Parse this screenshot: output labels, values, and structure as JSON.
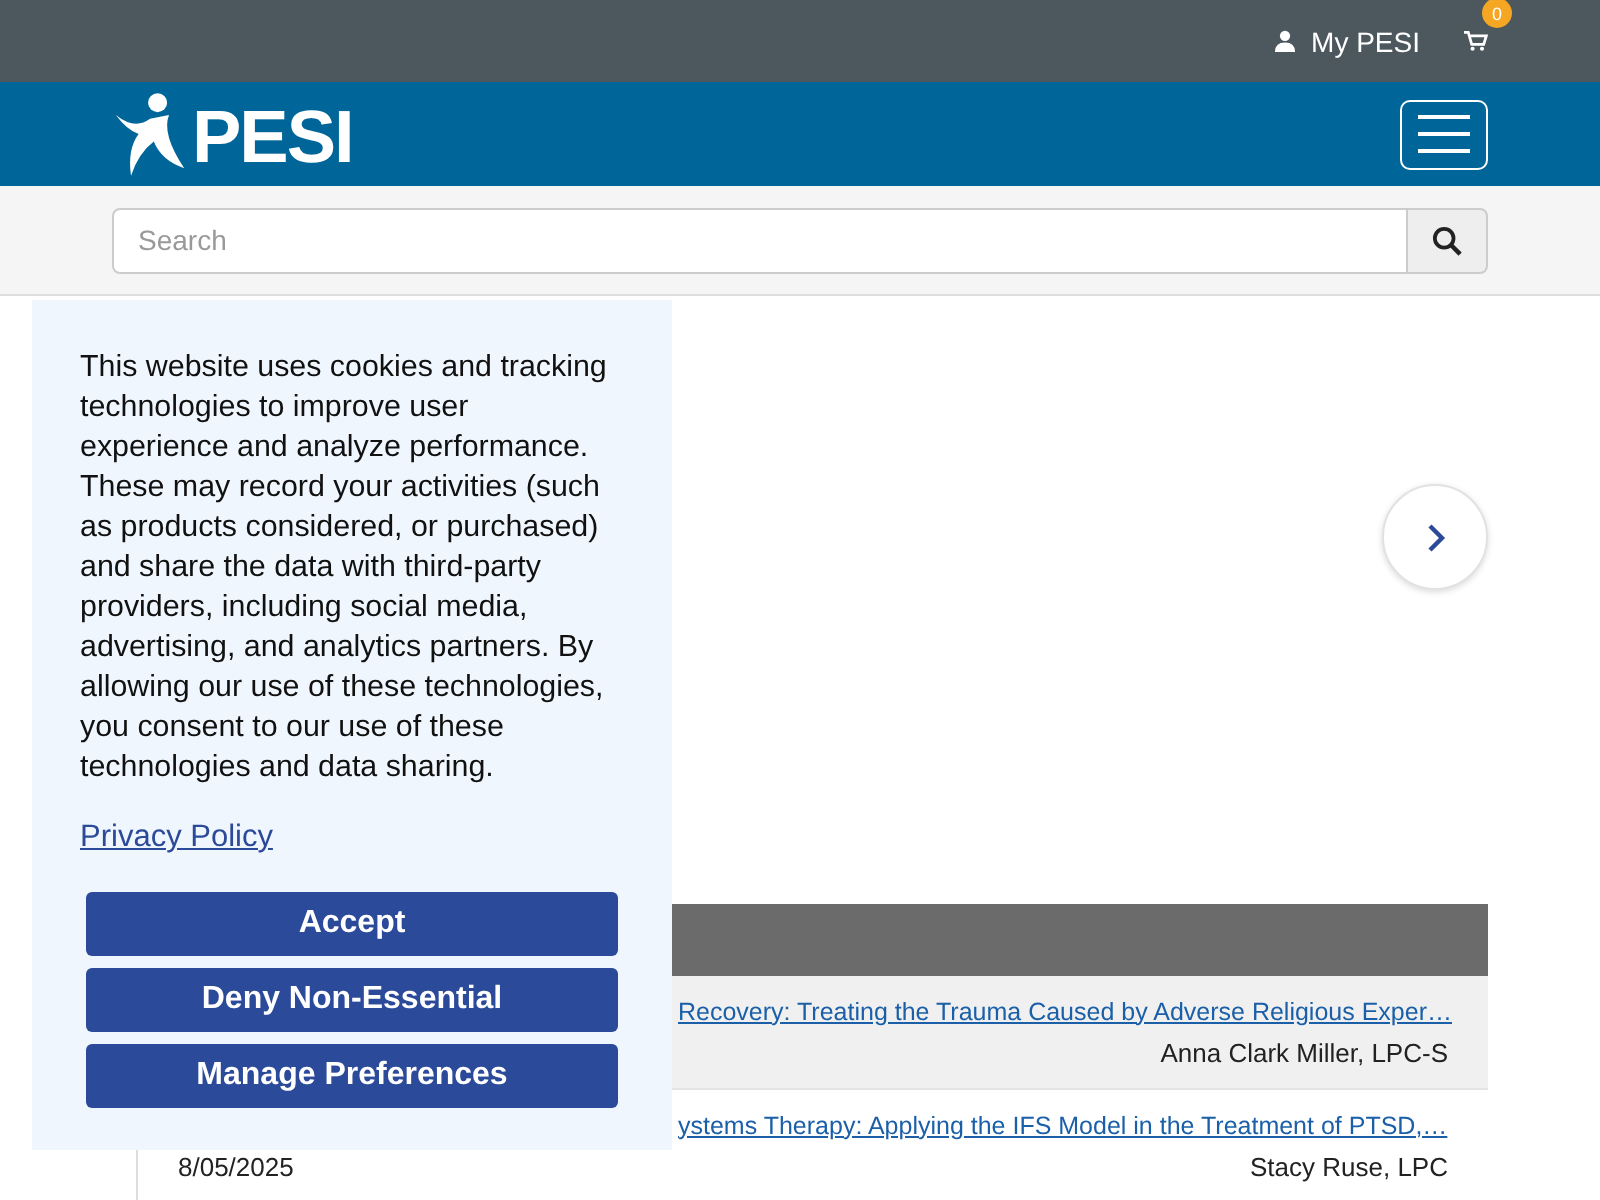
{
  "top_bar": {
    "account": "My PESI",
    "cart_count": "0"
  },
  "header": {
    "logo": "PESI"
  },
  "search": {
    "placeholder": "Search"
  },
  "table": {
    "rows": [
      {
        "title": "Recovery: Treating the Trauma Caused by Adverse Religious Exper…",
        "author": "Anna Clark Miller, LPC-S",
        "shaded": true
      },
      {
        "date": "8/05/2025",
        "title": "ystems Therapy: Applying the IFS Model in the Treatment of PTSD,…",
        "author": "Stacy Ruse, LPC",
        "shaded": false
      }
    ]
  },
  "cookie_banner": {
    "message": "This website uses cookies and tracking technologies to improve user experience and analyze performance. These may record your activities (such as products considered, or purchased) and share the data with third-party providers, including social media, advertising, and analytics partners. By allowing our use of these technologies, you consent to our use of these technologies and data sharing.",
    "link": "Privacy Policy",
    "buttons": [
      "Accept",
      "Deny Non-Essential",
      "Manage Preferences"
    ]
  }
}
